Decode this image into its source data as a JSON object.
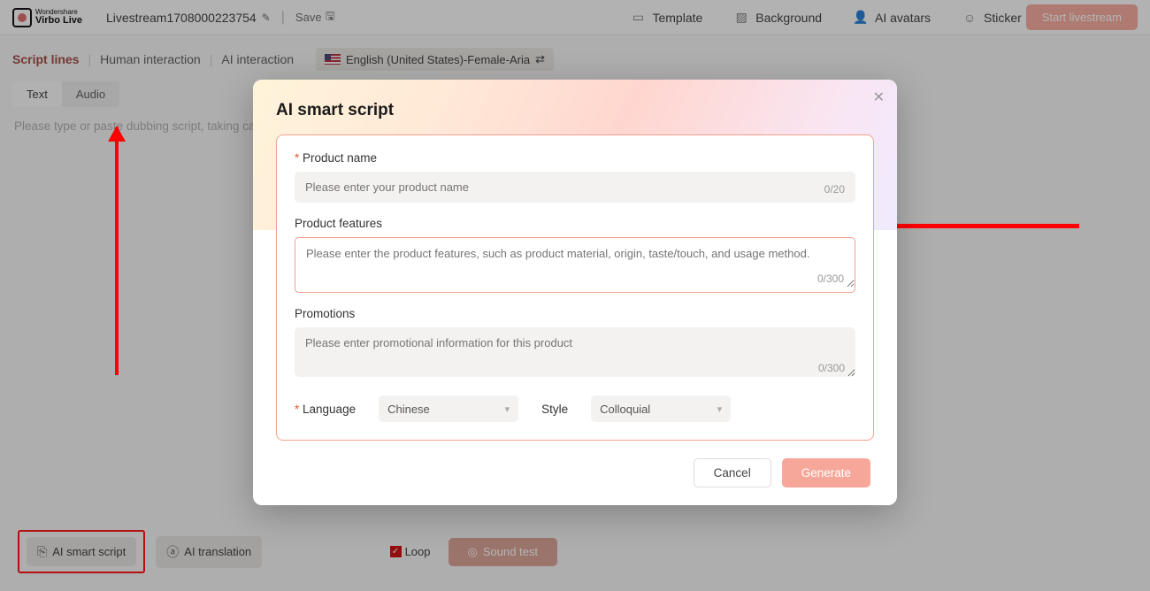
{
  "header": {
    "brand_line1": "Wondershare",
    "brand_line2": "Virbo Live",
    "project_name": "Livestream1708000223754",
    "save_label": "Save",
    "tools": {
      "template": "Template",
      "background": "Background",
      "ai_avatars": "AI avatars",
      "sticker": "Sticker"
    },
    "start_button": "Start livestream"
  },
  "left": {
    "tabs": {
      "script_lines": "Script lines",
      "human_interaction": "Human interaction",
      "ai_interaction": "AI interaction"
    },
    "lang_pill": "English (United States)-Female-Aria",
    "mode": {
      "text": "Text",
      "audio": "Audio"
    },
    "script_placeholder": "Please type or paste dubbing script, taking ca",
    "ai_smart_script": "AI smart script",
    "ai_translation": "AI translation",
    "loop": "Loop",
    "sound_test": "Sound test"
  },
  "modal": {
    "title": "AI smart script",
    "product_name_label": "Product name",
    "product_name_placeholder": "Please enter your product name",
    "product_name_count": "0/20",
    "product_features_label": "Product features",
    "product_features_placeholder": "Please enter the product features, such as product material, origin, taste/touch, and usage method.",
    "product_features_count": "0/300",
    "promotions_label": "Promotions",
    "promotions_placeholder": "Please enter promotional information for this product",
    "promotions_count": "0/300",
    "language_label": "Language",
    "language_value": "Chinese",
    "style_label": "Style",
    "style_value": "Colloquial",
    "cancel": "Cancel",
    "generate": "Generate"
  }
}
